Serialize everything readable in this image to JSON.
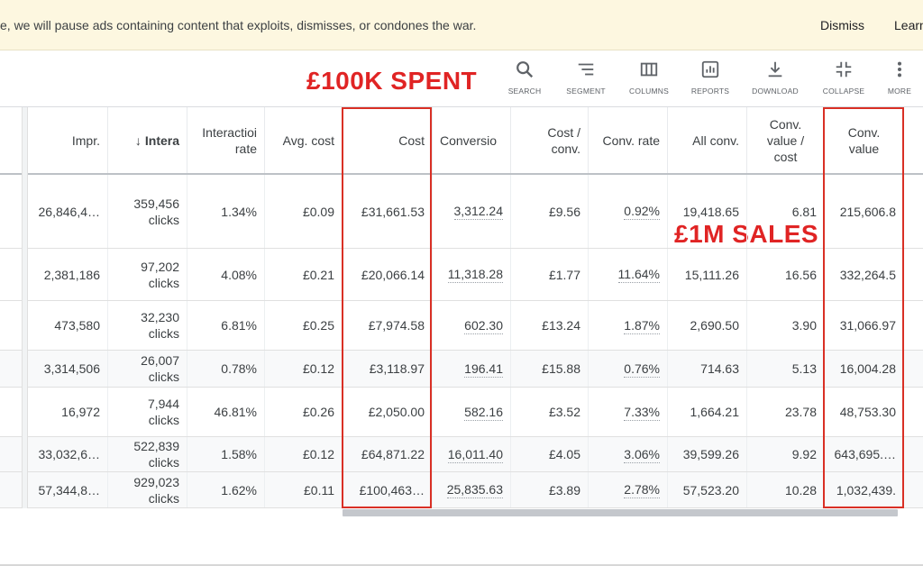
{
  "banner": {
    "text": "e, we will pause ads containing content that exploits, dismisses, or condones the war.",
    "dismiss": "Dismiss",
    "learn": "Learn"
  },
  "toolbar": {
    "tools": [
      {
        "label": "SEARCH",
        "icon": "search-icon"
      },
      {
        "label": "SEGMENT",
        "icon": "segment-icon"
      },
      {
        "label": "COLUMNS",
        "icon": "columns-icon"
      },
      {
        "label": "REPORTS",
        "icon": "reports-icon"
      },
      {
        "label": "DOWNLOAD",
        "icon": "download-icon"
      },
      {
        "label": "COLLAPSE",
        "icon": "collapse-icon"
      },
      {
        "label": "MORE",
        "icon": "more-vert-icon"
      }
    ]
  },
  "annotations": {
    "spent": "£100K SPENT",
    "sales": "£1M SALES",
    "color": "#e02424"
  },
  "headers": {
    "impr": "Impr.",
    "interactions": "Intera",
    "interaction_rate_l1": "Interactioi",
    "interaction_rate_l2": "rate",
    "avg_cost": "Avg. cost",
    "cost": "Cost",
    "conversions": "Conversio",
    "cost_conv_l1": "Cost /",
    "cost_conv_l2": "conv.",
    "conv_rate": "Conv. rate",
    "all_conv": "All conv.",
    "cvc_l1": "Conv.",
    "cvc_l2": "value /",
    "cvc_l3": "cost",
    "cv_l1": "Conv.",
    "cv_l2": "value"
  },
  "rows": [
    {
      "impr": "26,846,4…",
      "int_n": "359,456",
      "int_u": "clicks",
      "rate": "1.34%",
      "avg": "£0.09",
      "cost": "£31,661.53",
      "conv": "3,312.24",
      "cpc": "£9.56",
      "crate": "0.92%",
      "all": "19,418.65",
      "cvc": "6.81",
      "cv": "215,606.8"
    },
    {
      "impr": "2,381,186",
      "int_n": "97,202",
      "int_u": "clicks",
      "rate": "4.08%",
      "avg": "£0.21",
      "cost": "£20,066.14",
      "conv": "11,318.28",
      "cpc": "£1.77",
      "crate": "11.64%",
      "all": "15,111.26",
      "cvc": "16.56",
      "cv": "332,264.5"
    },
    {
      "impr": "473,580",
      "int_n": "32,230",
      "int_u": "clicks",
      "rate": "6.81%",
      "avg": "£0.25",
      "cost": "£7,974.58",
      "conv": "602.30",
      "cpc": "£13.24",
      "crate": "1.87%",
      "all": "2,690.50",
      "cvc": "3.90",
      "cv": "31,066.97"
    },
    {
      "impr": "3,314,506",
      "int_n": "26,007",
      "int_u": "clicks",
      "rate": "0.78%",
      "avg": "£0.12",
      "cost": "£3,118.97",
      "conv": "196.41",
      "cpc": "£15.88",
      "crate": "0.76%",
      "all": "714.63",
      "cvc": "5.13",
      "cv": "16,004.28"
    },
    {
      "impr": "16,972",
      "int_n": "7,944",
      "int_u": "clicks",
      "rate": "46.81%",
      "avg": "£0.26",
      "cost": "£2,050.00",
      "conv": "582.16",
      "cpc": "£3.52",
      "crate": "7.33%",
      "all": "1,664.21",
      "cvc": "23.78",
      "cv": "48,753.30"
    },
    {
      "impr": "33,032,6…",
      "int_n": "522,839",
      "int_u": "clicks",
      "rate": "1.58%",
      "avg": "£0.12",
      "cost": "£64,871.22",
      "conv": "16,011.40",
      "cpc": "£4.05",
      "crate": "3.06%",
      "all": "39,599.26",
      "cvc": "9.92",
      "cv": "643,695.…"
    },
    {
      "impr": "57,344,8…",
      "int_n": "929,023",
      "int_u": "clicks",
      "rate": "1.62%",
      "avg": "£0.11",
      "cost": "£100,463…",
      "conv": "25,835.63",
      "cpc": "£3.89",
      "crate": "2.78%",
      "all": "57,523.20",
      "cvc": "10.28",
      "cv": "1,032,439."
    }
  ]
}
